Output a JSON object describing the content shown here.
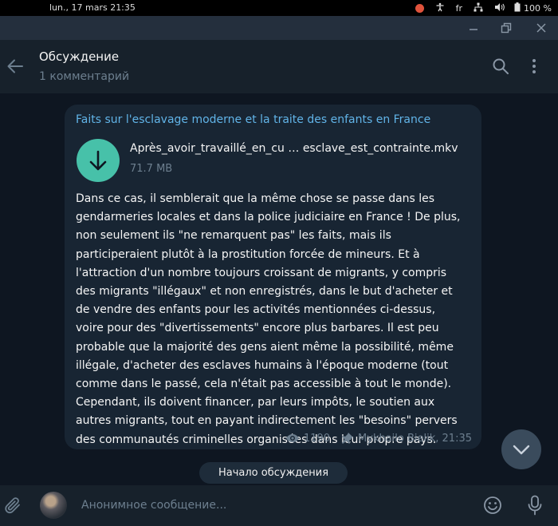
{
  "sysbar": {
    "clock": "lun., 17 mars  21:35",
    "lang": "fr",
    "battery": "100 %"
  },
  "window": {
    "controls": [
      "minimize-icon",
      "restore-icon",
      "close-icon"
    ]
  },
  "header": {
    "title": "Обсуждение",
    "subtitle": "1 комментарий"
  },
  "message": {
    "forward_title": "Faits sur l'esclavage moderne et la traite des enfants en France",
    "file_name": "Après_avoir_travaillé_en_cu … esclave_est_contrainte.mkv",
    "file_size": "71.7 MB",
    "text": "Dans ce cas, il semblerait que la même chose se passe dans les\ngendarmeries locales et dans la police judiciaire en France ! De plus,\nnon seulement ils \"ne remarquent pas\" les faits, mais ils\nparticiperaient plutôt à la prostitution forcée de mineurs. Et à\nl'attraction d'un nombre toujours croissant de migrants, y compris\ndes migrants \"illégaux\" et non enregistrés, dans le but d'acheter et\nde vendre des enfants pour les activités mentionnées ci-dessus,\nvoire pour des \"divertissements\" encore plus barbares. Il est peu\nprobable que la majorité des gens aient même la possibilité, même\nillégale, d'acheter des esclaves humains à l'époque moderne (tout\ncomme dans le passé, cela n'était pas accessible à tout le monde).\nCependant, ils doivent financer, par leurs impôts, le soutien aux\nautres migrants, tout en payant indirectement les \"besoins\" pervers\ndes communautés criminelles organisées dans leur propre pays.",
    "views": "1190",
    "author_time": "Mykhailo Bielik, 21:35"
  },
  "discussion_start": "Начало обсуждения",
  "composer": {
    "placeholder": "Анонимное сообщение..."
  },
  "colors": {
    "background": "#0e1621",
    "header": "#17212b",
    "bubble": "#182533",
    "link": "#61b4e8",
    "download": "#47c1a9"
  }
}
